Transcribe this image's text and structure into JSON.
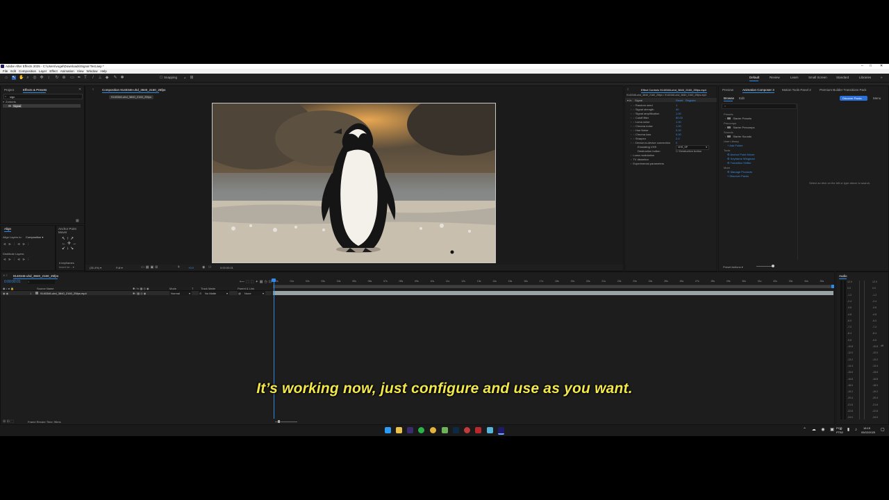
{
  "window": {
    "title": "Adobe After Effects 2025 - C:\\Users\\vogel\\Downloads\\Signal Test.aep *",
    "minimize": "–",
    "maximize": "□",
    "close": "✕"
  },
  "menu": [
    "File",
    "Edit",
    "Composition",
    "Layer",
    "Effect",
    "Animation",
    "View",
    "Window",
    "Help"
  ],
  "toolbar": {
    "snapping_label": "Snapping",
    "workspaces": [
      "Default",
      "Review",
      "Learn",
      "Small Screen",
      "Standard",
      "Libraries"
    ],
    "active_workspace": "Default"
  },
  "project_panel": {
    "tabs": [
      "Project",
      "Effects & Presets"
    ],
    "search_value": "sign",
    "category": "Zorberts",
    "item": "Signal"
  },
  "align_panel": {
    "tabs": [
      "Align",
      "Anchor Point Mover"
    ],
    "align_layers_to_label": "Align Layers to:",
    "align_layers_to_value": "Composition",
    "distribute_label": "Distribute Layers:",
    "keyframe_label": "# keyframes"
  },
  "composition_panel": {
    "tab": "Composition 9140346-uhd_3840_2160_25fps",
    "sub_tab": "9140346-uhd_3840_2160_25fps",
    "zoom": "(35.4%)",
    "resolution": "Full",
    "timecode": "0:00:00:01",
    "exposure": "+0.0"
  },
  "effect_controls": {
    "tab": "Effect Controls 9140346-uhd_3840_2160_25fps.mp4",
    "layer_path": "9140346-uhd_3840_2160_25fps • 9140346-uhd_3840_2160_25fps.mp4",
    "effect_name": "Signal",
    "reset": "Reset",
    "register": "Register",
    "params": [
      {
        "name": "Random seed",
        "value": "1"
      },
      {
        "name": "Signal strength",
        "value": "40"
      },
      {
        "name": "Signal amplification",
        "value": "1.00"
      },
      {
        "name": "Cutoff filter",
        "value": "80.00"
      },
      {
        "name": "Luma noise",
        "value": "1.00"
      },
      {
        "name": "Chroma noise",
        "value": "1.00"
      },
      {
        "name": "Hue Noise",
        "value": "0.00"
      },
      {
        "name": "Chroma loss",
        "value": "0.00"
      },
      {
        "name": "Sharpen",
        "value": "2.0"
      },
      {
        "name": "Device-to-device connection",
        "value": "0"
      }
    ],
    "emulating_label": "Emulating VHS",
    "emulating_value": "VHS_SP",
    "destruction_label": "Destruction button",
    "destruction_checkbox": "Destruction button",
    "groups": [
      "Luma modulation",
      "TV distortion",
      "Experimental parameters"
    ]
  },
  "right_panel": {
    "tabs": [
      "Preview",
      "Animation Composer 3",
      "Motion Tools Panel 2",
      "Premium Builder Transitions Pack"
    ],
    "sub_tabs": [
      "Browse",
      "Edit"
    ],
    "discover_button": "Discover Packs",
    "menu": "Menu",
    "sections": [
      {
        "header": "Presets",
        "items": [
          {
            "label": "Starter Presets",
            "type": "folder"
          }
        ]
      },
      {
        "header": "Precomps",
        "items": [
          {
            "label": "Starter Precomps",
            "type": "folder"
          }
        ]
      },
      {
        "header": "Sounds",
        "items": [
          {
            "label": "Starter Sounds",
            "type": "folder"
          }
        ]
      },
      {
        "header": "User Library",
        "items": [
          {
            "label": "Add Folder",
            "type": "link"
          }
        ]
      },
      {
        "header": "Tools",
        "items": [
          {
            "label": "Anchor Point Mover",
            "type": "link"
          },
          {
            "label": "Keyframe Wingman",
            "type": "link"
          },
          {
            "label": "Transition Shifter",
            "type": "link"
          }
        ]
      },
      {
        "header": "More",
        "items": [
          {
            "label": "Manage Products",
            "type": "link"
          },
          {
            "label": "Discover Packs",
            "type": "link"
          }
        ]
      }
    ],
    "hint": "Select an item on the left or type above to search.",
    "preset_actions": "Preset Actions"
  },
  "timeline": {
    "tab": "9140346-uhd_3840_2160_25fps",
    "timecode": "0:00:00:01",
    "columns": [
      "Source Name",
      "Mode",
      "T",
      "Track Matte",
      "Parent & Link"
    ],
    "layer": {
      "number": "1",
      "name": "9140346-uhd_3840_2160_25fps.mp4",
      "mode": "Normal",
      "matte": "No Matte",
      "parent": "None"
    },
    "ruler": [
      "00s",
      "01s",
      "02s",
      "03s",
      "04s",
      "05s",
      "06s",
      "07s",
      "08s",
      "09s",
      "10s",
      "11s",
      "12s",
      "13s",
      "14s",
      "15s",
      "16s",
      "17s",
      "18s",
      "19s",
      "20s",
      "21s",
      "22s",
      "23s",
      "24s",
      "25s",
      "26s",
      "27s",
      "28s",
      "29s",
      "30s",
      "31s",
      "32s",
      "33s",
      "34s",
      "35s",
      "36s"
    ],
    "footer": "Frame Render Time: 96ms"
  },
  "audio_panel": {
    "tab": "Audio",
    "left_scale": [
      "12.0",
      "0.0",
      "-1.2",
      "-2.4",
      "-3.6",
      "-4.8",
      "-6.0",
      "-7.2",
      "-8.4",
      "-9.6",
      "-10.8",
      "-12.0",
      "-13.2",
      "-14.4",
      "-15.6",
      "-16.8",
      "-18.0",
      "-19.2",
      "-20.4",
      "-21.6",
      "-22.8",
      "-24.0"
    ],
    "right_scale": [
      "12.0",
      "0.0",
      "-1.2",
      "-2.4",
      "-3.6",
      "-4.8",
      "-6.0",
      "-7.2",
      "-8.4",
      "-9.6",
      "-10.8",
      "-12.0",
      "-13.2",
      "-14.4",
      "-15.6",
      "-16.8",
      "-18.0",
      "-19.2",
      "-20.4",
      "-21.6",
      "-22.8",
      "-24.0"
    ],
    "right_label": "dB"
  },
  "caption": "It’s working now, just configure and use as you want.",
  "taskbar": {
    "lang_top": "POR",
    "lang_bottom": "PTB2",
    "time": "18:15",
    "date": "05/02/2025"
  },
  "colors": {
    "accent": "#2d8ceb",
    "caption": "#f2e84a",
    "panel_bg": "#1d1d1d"
  }
}
